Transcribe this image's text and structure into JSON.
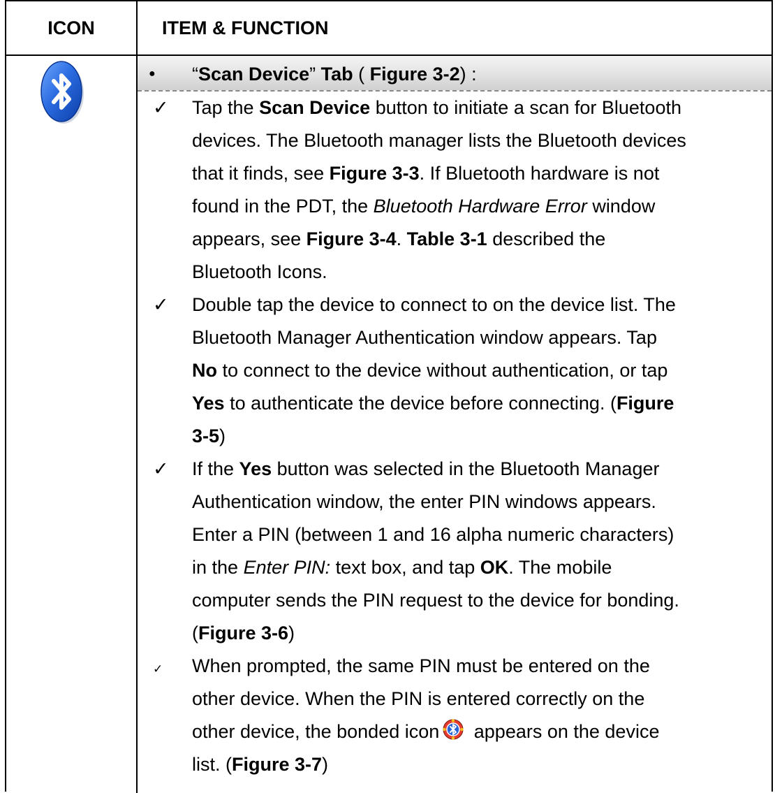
{
  "header": {
    "icon_col": "ICON",
    "item_col": "ITEM & FUNCTION"
  },
  "section": {
    "open_quote": "“",
    "title_bold": "Scan Device",
    "title_close": "” ",
    "tab_bold": "Tab",
    "paren_open": " ( ",
    "figure_bold": "Figure 3-2",
    "paren_close": ") :"
  },
  "bullets": [
    {
      "lines": [
        [
          {
            "t": "Tap the "
          },
          {
            "t": "Scan Device",
            "b": true
          },
          {
            "t": " button to initiate a scan for Bluetooth"
          }
        ],
        [
          {
            "t": "devices. The Bluetooth manager lists the Bluetooth devices"
          }
        ],
        [
          {
            "t": "that it finds, see "
          },
          {
            "t": "Figure 3-3",
            "b": true
          },
          {
            "t": ". If Bluetooth hardware is not"
          }
        ],
        [
          {
            "t": "found in the PDT, the "
          },
          {
            "t": "Bluetooth Hardware Error",
            "i": true
          },
          {
            "t": " window"
          }
        ],
        [
          {
            "t": "appears, see "
          },
          {
            "t": "Figure 3-4",
            "b": true
          },
          {
            "t": ". "
          },
          {
            "t": "Table 3-1",
            "b": true
          },
          {
            "t": " described the"
          }
        ],
        [
          {
            "t": "Bluetooth Icons."
          }
        ]
      ]
    },
    {
      "lines": [
        [
          {
            "t": "Double tap the device to connect to on the device list. The"
          }
        ],
        [
          {
            "t": "Bluetooth Manager Authentication window appears. Tap"
          }
        ],
        [
          {
            "t": "No",
            "b": true
          },
          {
            "t": " to connect to the device without authentication, or tap"
          }
        ],
        [
          {
            "t": "Yes",
            "b": true
          },
          {
            "t": " to authenticate the device before connecting. ("
          },
          {
            "t": "Figure",
            "b": true
          }
        ],
        [
          {
            "t": "3-5",
            "b": true
          },
          {
            "t": ")"
          }
        ]
      ]
    },
    {
      "lines": [
        [
          {
            "t": "If the "
          },
          {
            "t": "Yes",
            "b": true
          },
          {
            "t": " button was selected in the Bluetooth Manager"
          }
        ],
        [
          {
            "t": "Authentication window, the enter PIN windows appears."
          }
        ],
        [
          {
            "t": "Enter a PIN (between 1 and 16 alpha numeric characters)"
          }
        ],
        [
          {
            "t": "in the "
          },
          {
            "t": "Enter PIN:",
            "i": true
          },
          {
            "t": " text box, and tap "
          },
          {
            "t": "OK",
            "b": true
          },
          {
            "t": ". The mobile"
          }
        ],
        [
          {
            "t": "computer sends the PIN request to the device for bonding."
          }
        ],
        [
          {
            "t": "("
          },
          {
            "t": "Figure 3-6",
            "b": true
          },
          {
            "t": ")"
          }
        ]
      ]
    },
    {
      "small_check": true,
      "lines": [
        [
          {
            "t": "When prompted, the same PIN must be entered on the"
          }
        ],
        [
          {
            "t": "other device. When the PIN is entered correctly on the"
          }
        ],
        [
          {
            "t": "other device, the bonded icon"
          },
          {
            "icon": "bonded-icon"
          },
          {
            "t": " appears on the device"
          }
        ],
        [
          {
            "t": "list. ("
          },
          {
            "t": "Figure 3-7",
            "b": true
          },
          {
            "t": ")"
          }
        ]
      ]
    }
  ],
  "check_mark": "✓",
  "bullet_mark": "●",
  "icons": {
    "main": "bluetooth-icon",
    "inline": "bonded-icon"
  },
  "colors": {
    "bluetooth_blue": "#1f5fd6",
    "border": "#000000"
  }
}
